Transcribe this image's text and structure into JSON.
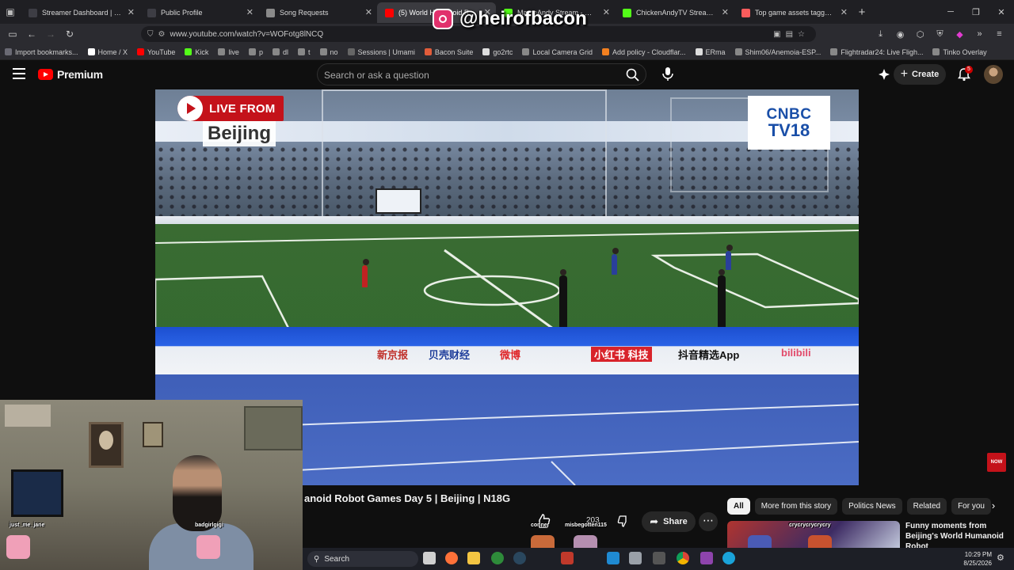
{
  "browser": {
    "tabs": [
      {
        "label": "Streamer Dashboard | Tinkobot",
        "active": false,
        "icon": "tinkobot-icon",
        "color": "#3d3d44"
      },
      {
        "label": "Public Profile",
        "active": false,
        "icon": "profile-icon",
        "color": "#3d3d44"
      },
      {
        "label": "Song Requests",
        "active": false,
        "icon": "settings-icon",
        "color": "#8a8a8a"
      },
      {
        "label": "(5) World Humanoid Robot",
        "active": true,
        "icon": "youtube-icon",
        "color": "#ff0000"
      },
      {
        "label": "MamaAndy Stream - Watch L",
        "active": false,
        "icon": "kick-icon",
        "color": "#53fc18"
      },
      {
        "label": "ChickenAndyTV Stream - W",
        "active": false,
        "icon": "kick-icon",
        "color": "#53fc18"
      },
      {
        "label": "Top game assets tagged poker",
        "active": false,
        "icon": "itch-icon",
        "color": "#fa5c5c"
      }
    ],
    "url": "www.youtube.com/watch?v=WOFotg8lNCQ",
    "bookmarks": [
      {
        "label": "Import bookmarks...",
        "color": "#6a6a74"
      },
      {
        "label": "Home / X",
        "color": "#ffffff"
      },
      {
        "label": "YouTube",
        "color": "#ff0000"
      },
      {
        "label": "Kick",
        "color": "#53fc18"
      },
      {
        "label": "live",
        "color": "#888"
      },
      {
        "label": "p",
        "color": "#888"
      },
      {
        "label": "dl",
        "color": "#888"
      },
      {
        "label": "t",
        "color": "#888"
      },
      {
        "label": "no",
        "color": "#888"
      },
      {
        "label": "Sessions | Umami",
        "color": "#666"
      },
      {
        "label": "Bacon Suite",
        "color": "#e25c3a"
      },
      {
        "label": "go2rtc",
        "color": "#ddd"
      },
      {
        "label": "Local Camera Grid",
        "color": "#888"
      },
      {
        "label": "Add policy - Cloudflar...",
        "color": "#f38020"
      },
      {
        "label": "ERma",
        "color": "#ddd"
      },
      {
        "label": "Shim06/Anemoia-ESP...",
        "color": "#888"
      },
      {
        "label": "Flightradar24: Live Fligh...",
        "color": "#888"
      },
      {
        "label": "Tinko Overlay",
        "color": "#888"
      }
    ]
  },
  "watermark": {
    "handle": "@heirofbacon"
  },
  "youtube": {
    "logo_text": "Premium",
    "search_placeholder": "Search or ask a question",
    "create_label": "Create",
    "notification_count": "5",
    "video": {
      "live_badge": "LIVE FROM",
      "location": "Beijing",
      "channel_logo_line1": "CNBC",
      "channel_logo_line2": "TV18",
      "ads": [
        "新京报",
        "贝壳财经",
        "微博",
        "小红书 科技",
        "抖音精选App",
        "bilibili"
      ]
    },
    "title": "anoid Robot Games Day 5 | Beijing | N18G",
    "like_count": "203",
    "share_label": "Share",
    "chips": [
      {
        "label": "All",
        "active": true
      },
      {
        "label": "More from this story",
        "active": false
      },
      {
        "label": "Politics News",
        "active": false
      },
      {
        "label": "Related",
        "active": false
      },
      {
        "label": "For you",
        "active": false
      }
    ],
    "recommended_title": "Funny moments from Beijing's World Humanoid Robot",
    "now_badge": "NOW"
  },
  "overlay": {
    "chat_names": [
      "just_me_jane",
      "badgirlgigi",
      "conner",
      "misbegotten115",
      "crycrycrycrycry"
    ]
  },
  "taskbar": {
    "search_label": "Search",
    "time": "10:29 PM",
    "date": "8/25/2026"
  }
}
